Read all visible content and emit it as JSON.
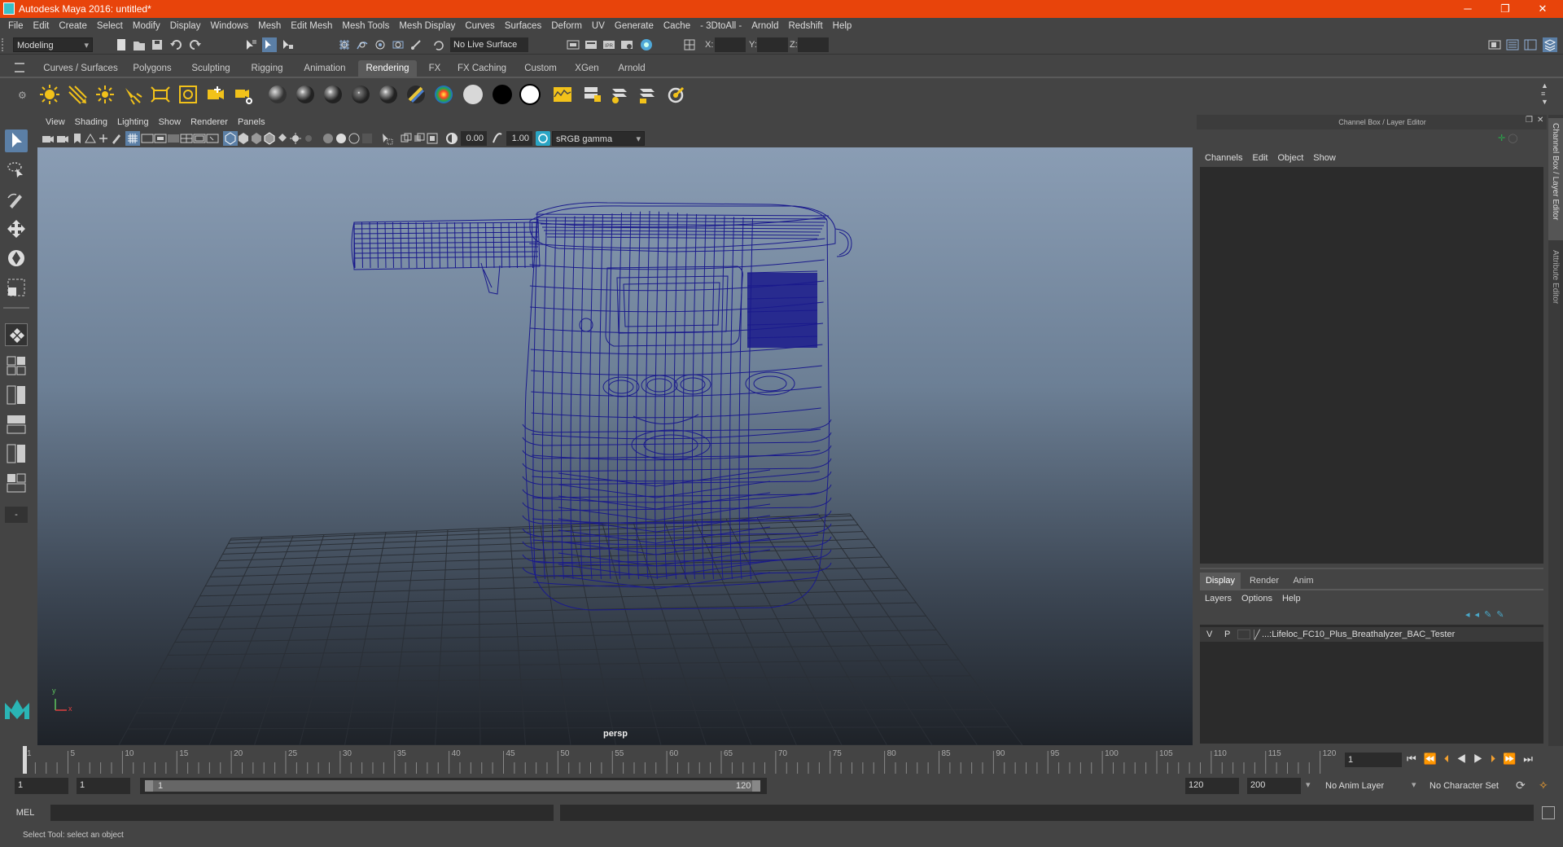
{
  "title_bar": {
    "title": "Autodesk Maya 2016: untitled*",
    "minimize": "─",
    "maximize": "❐",
    "close": "✕"
  },
  "menu": [
    "File",
    "Edit",
    "Create",
    "Select",
    "Modify",
    "Display",
    "Windows",
    "Mesh",
    "Edit Mesh",
    "Mesh Tools",
    "Mesh Display",
    "Curves",
    "Surfaces",
    "Deform",
    "UV",
    "Generate",
    "Cache",
    "- 3DtoAll -",
    "Arnold",
    "Redshift",
    "Help"
  ],
  "status_line": {
    "mode": "Modeling",
    "live_surface": "No Live Surface",
    "x_label": "X:",
    "y_label": "Y:",
    "z_label": "Z:"
  },
  "shelf_tabs": [
    "Curves / Surfaces",
    "Polygons",
    "Sculpting",
    "Rigging",
    "Animation",
    "Rendering",
    "FX",
    "FX Caching",
    "Custom",
    "XGen",
    "Arnold"
  ],
  "active_shelf_tab": "Rendering",
  "viewport": {
    "menu": [
      "View",
      "Shading",
      "Lighting",
      "Show",
      "Renderer",
      "Panels"
    ],
    "exposure": "0.00",
    "gamma": "1.00",
    "color_space": "sRGB gamma",
    "camera": "persp",
    "axis_x": "x",
    "axis_y": "y",
    "wire_color": "#1a1a8c"
  },
  "channel_box": {
    "header": "Channel Box / Layer Editor",
    "menu": [
      "Channels",
      "Edit",
      "Object",
      "Show"
    ],
    "layer_tabs": [
      "Display",
      "Render",
      "Anim"
    ],
    "active_layer_tab": "Display",
    "layer_menu": [
      "Layers",
      "Options",
      "Help"
    ],
    "layer": {
      "v": "V",
      "p": "P",
      "name": "...:Lifeloc_FC10_Plus_Breathalyzer_BAC_Tester"
    }
  },
  "side_tabs": [
    "Channel Box / Layer Editor",
    "Attribute Editor"
  ],
  "time_slider": {
    "ticks": [
      "1",
      "5",
      "10",
      "15",
      "20",
      "25",
      "30",
      "35",
      "40",
      "45",
      "50",
      "55",
      "60",
      "65",
      "70",
      "75",
      "80",
      "85",
      "90",
      "95",
      "100",
      "105",
      "110",
      "115",
      "120"
    ],
    "current_frame": "1"
  },
  "range_slider": {
    "start": "1",
    "playback_start": "1",
    "range_start_label": "1",
    "range_end_label": "120",
    "playback_end": "120",
    "end": "200",
    "anim_layer": "No Anim Layer",
    "character_set": "No Character Set"
  },
  "command_line": {
    "label": "MEL"
  },
  "help_line": {
    "text": "Select Tool: select an object"
  }
}
